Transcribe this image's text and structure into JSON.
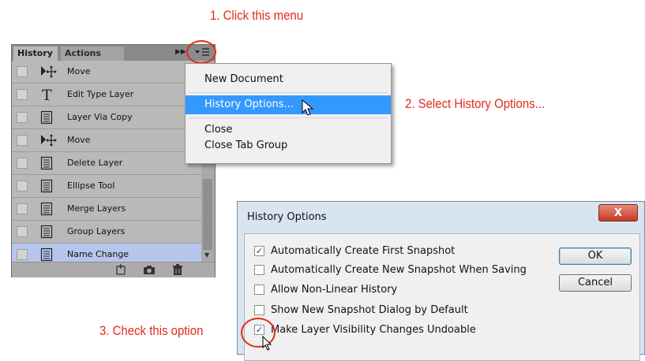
{
  "annotations": {
    "step1": "1. Click this menu",
    "step2": "2. Select History Options...",
    "step3": "3. Check this option"
  },
  "history_panel": {
    "tabs": [
      "History",
      "Actions"
    ],
    "items": [
      {
        "label": "Move",
        "icon": "move-icon"
      },
      {
        "label": "Edit Type Layer",
        "icon": "type-icon"
      },
      {
        "label": "Layer Via Copy",
        "icon": "document-icon"
      },
      {
        "label": "Move",
        "icon": "move-icon"
      },
      {
        "label": "Delete Layer",
        "icon": "document-icon"
      },
      {
        "label": "Ellipse Tool",
        "icon": "document-icon"
      },
      {
        "label": "Merge Layers",
        "icon": "document-icon"
      },
      {
        "label": "Group Layers",
        "icon": "document-icon"
      },
      {
        "label": "Name Change",
        "icon": "document-icon",
        "selected": true
      }
    ],
    "footer_icons": [
      "new-document-from-state-icon",
      "camera-icon",
      "trash-icon"
    ]
  },
  "panel_menu": {
    "items": [
      "New Document",
      "History Options...",
      "Close",
      "Close Tab Group"
    ],
    "highlighted": "History Options..."
  },
  "dialog": {
    "title": "History Options",
    "close_label": "X",
    "options": [
      {
        "label": "Automatically Create First Snapshot",
        "checked": true
      },
      {
        "label": "Automatically Create New Snapshot When Saving",
        "checked": false
      },
      {
        "label": "Allow Non-Linear History",
        "checked": false
      },
      {
        "label": "Show New Snapshot Dialog by Default",
        "checked": false
      },
      {
        "label": "Make Layer Visibility Changes Undoable",
        "checked": true
      }
    ],
    "ok_label": "OK",
    "cancel_label": "Cancel"
  },
  "colors": {
    "annotation": "#e02b1a",
    "menu_highlight": "#3399ff",
    "selected_row": "#b6c6ea"
  }
}
